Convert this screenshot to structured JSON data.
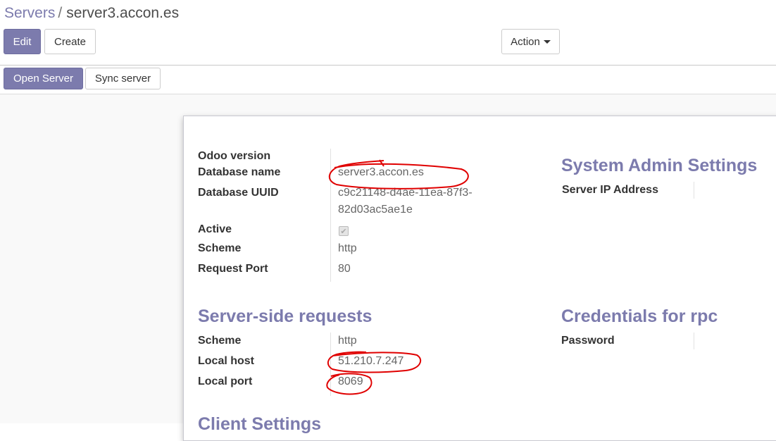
{
  "breadcrumb": {
    "parent": "Servers",
    "separator": "/",
    "current": "server3.accon.es"
  },
  "toolbar": {
    "edit_label": "Edit",
    "create_label": "Create",
    "action_label": "Action"
  },
  "statusbar": {
    "open_label": "Open Server",
    "sync_label": "Sync server"
  },
  "general": {
    "odoo_version_label": "Odoo version",
    "odoo_version_value": "",
    "db_name_label": "Database name",
    "db_name_value": "server3.accon.es",
    "db_uuid_label": "Database UUID",
    "db_uuid_line1": "c9c21148-d4ae-11ea-87f3-",
    "db_uuid_line2": "82d03ac5ae1e",
    "active_label": "Active",
    "active_value": true,
    "scheme_label": "Scheme",
    "scheme_value": "http",
    "port_label": "Request Port",
    "port_value": "80"
  },
  "sysadmin": {
    "title": "System Admin Settings",
    "server_ip_label": "Server IP Address",
    "server_ip_value": ""
  },
  "server_side": {
    "title": "Server-side requests",
    "scheme_label": "Scheme",
    "scheme_value": "http",
    "local_host_label": "Local host",
    "local_host_value": "51.210.7.247",
    "local_port_label": "Local port",
    "local_port_value": "8069"
  },
  "credentials": {
    "title": "Credentials for rpc",
    "password_label": "Password",
    "password_value": ""
  },
  "next_section": {
    "title": "Client Settings"
  },
  "colors": {
    "accent": "#7c7bad",
    "annotation": "#e00000"
  }
}
